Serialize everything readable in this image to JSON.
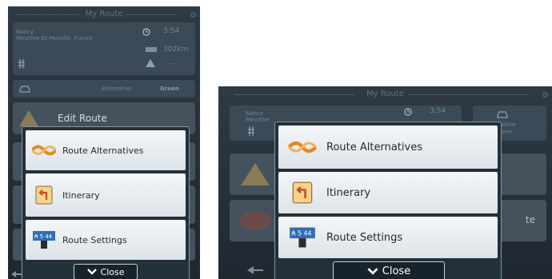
{
  "title": "My Route",
  "route": {
    "city": "Nancy",
    "region": "Meurthe-Et-Moselle, France",
    "region_short": "Meurthe",
    "time": "3:54",
    "distance": "302km",
    "warning_value": "-:--",
    "alternative_label": "Alternative",
    "green_label": "Green",
    "alternative_short": "ative",
    "green_short": "een"
  },
  "background": {
    "edit_route": "Edit Route",
    "partial_label": "te"
  },
  "menu": {
    "items": [
      {
        "label": "Route Alternatives",
        "icon": "route-alternatives-icon"
      },
      {
        "label": "Itinerary",
        "icon": "itinerary-icon"
      },
      {
        "label": "Route Settings",
        "icon": "route-settings-icon"
      }
    ],
    "close_label": "Close"
  },
  "colors": {
    "screen_bg": "#2e3a44",
    "dialog_border": "#8595a2",
    "item_bg": "#e9edf0"
  }
}
